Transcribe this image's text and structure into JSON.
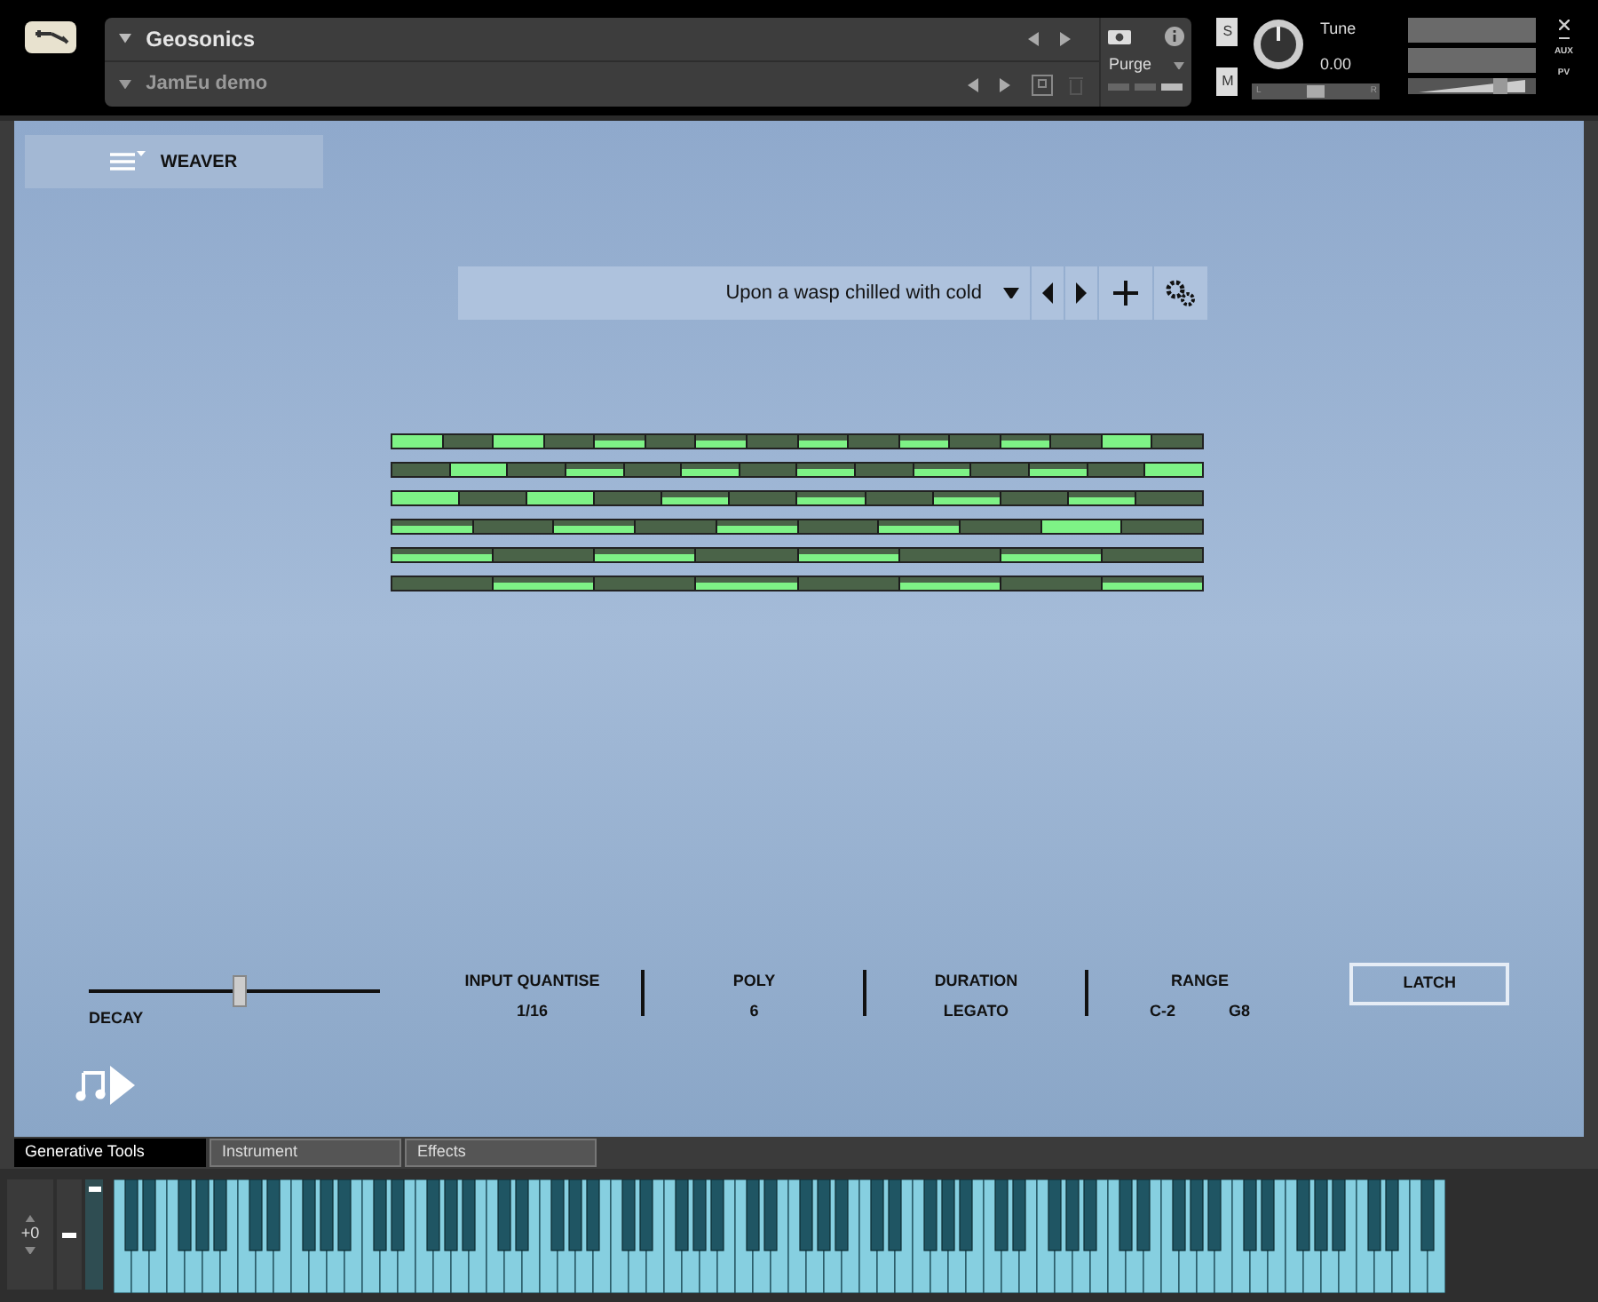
{
  "header": {
    "instrument_name": "Geosonics",
    "snapshot_name": "JamEu demo",
    "purge": "Purge",
    "solo": "S",
    "mute": "M",
    "tune_label": "Tune",
    "tune_value": "0.00",
    "pan": {
      "left": "L",
      "right": "R",
      "level": 0.5
    },
    "volume": {
      "level": 0.75
    },
    "aux": "AUX",
    "pv": "PV"
  },
  "menu": {
    "label": "WEAVER"
  },
  "preset": {
    "name": "Upon a wasp chilled with cold"
  },
  "sequencer_rows": [
    {
      "steps": [
        {
          "kind": "full"
        },
        {
          "kind": "off"
        },
        {
          "kind": "full"
        },
        {
          "kind": "off"
        },
        {
          "kind": "thin"
        },
        {
          "kind": "off"
        },
        {
          "kind": "thin"
        },
        {
          "kind": "off"
        },
        {
          "kind": "thin"
        },
        {
          "kind": "off"
        },
        {
          "kind": "thin"
        },
        {
          "kind": "off"
        },
        {
          "kind": "thin"
        },
        {
          "kind": "off"
        },
        {
          "kind": "full"
        },
        {
          "kind": "off"
        }
      ]
    },
    {
      "steps": [
        {
          "kind": "off"
        },
        {
          "kind": "full"
        },
        {
          "kind": "off"
        },
        {
          "kind": "thin"
        },
        {
          "kind": "off"
        },
        {
          "kind": "thin"
        },
        {
          "kind": "off"
        },
        {
          "kind": "thin"
        },
        {
          "kind": "off"
        },
        {
          "kind": "thin"
        },
        {
          "kind": "off"
        },
        {
          "kind": "thin"
        },
        {
          "kind": "off"
        },
        {
          "kind": "full"
        }
      ]
    },
    {
      "steps": [
        {
          "kind": "full"
        },
        {
          "kind": "off"
        },
        {
          "kind": "full"
        },
        {
          "kind": "off"
        },
        {
          "kind": "thin"
        },
        {
          "kind": "off"
        },
        {
          "kind": "thin"
        },
        {
          "kind": "off"
        },
        {
          "kind": "thin"
        },
        {
          "kind": "off"
        },
        {
          "kind": "thin"
        },
        {
          "kind": "off"
        }
      ]
    },
    {
      "steps": [
        {
          "kind": "thin"
        },
        {
          "kind": "off"
        },
        {
          "kind": "thin"
        },
        {
          "kind": "off"
        },
        {
          "kind": "thin"
        },
        {
          "kind": "off"
        },
        {
          "kind": "thin"
        },
        {
          "kind": "off"
        },
        {
          "kind": "full"
        },
        {
          "kind": "off"
        }
      ]
    },
    {
      "steps": [
        {
          "kind": "thin"
        },
        {
          "kind": "off"
        },
        {
          "kind": "thin"
        },
        {
          "kind": "off"
        },
        {
          "kind": "thin"
        },
        {
          "kind": "off"
        },
        {
          "kind": "thin"
        },
        {
          "kind": "off"
        }
      ]
    },
    {
      "steps": [
        {
          "kind": "off"
        },
        {
          "kind": "thin"
        },
        {
          "kind": "off"
        },
        {
          "kind": "thin"
        },
        {
          "kind": "off"
        },
        {
          "kind": "thin"
        },
        {
          "kind": "off"
        },
        {
          "kind": "thin"
        }
      ]
    }
  ],
  "decay": {
    "label": "DECAY",
    "level": 0.47
  },
  "params": [
    {
      "label": "INPUT QUANTISE",
      "values": [
        "1/16"
      ]
    },
    {
      "label": "POLY",
      "values": [
        "6"
      ]
    },
    {
      "label": "DURATION",
      "values": [
        "LEGATO"
      ]
    },
    {
      "label": "RANGE",
      "values": [
        "C-2",
        "G8"
      ]
    }
  ],
  "latch": {
    "label": "LATCH",
    "on": false
  },
  "tabs": [
    {
      "label": "Generative Tools",
      "selected": true
    },
    {
      "label": "Instrument",
      "selected": false
    },
    {
      "label": "Effects",
      "selected": false
    }
  ],
  "keyboard": {
    "octave": "+0"
  }
}
